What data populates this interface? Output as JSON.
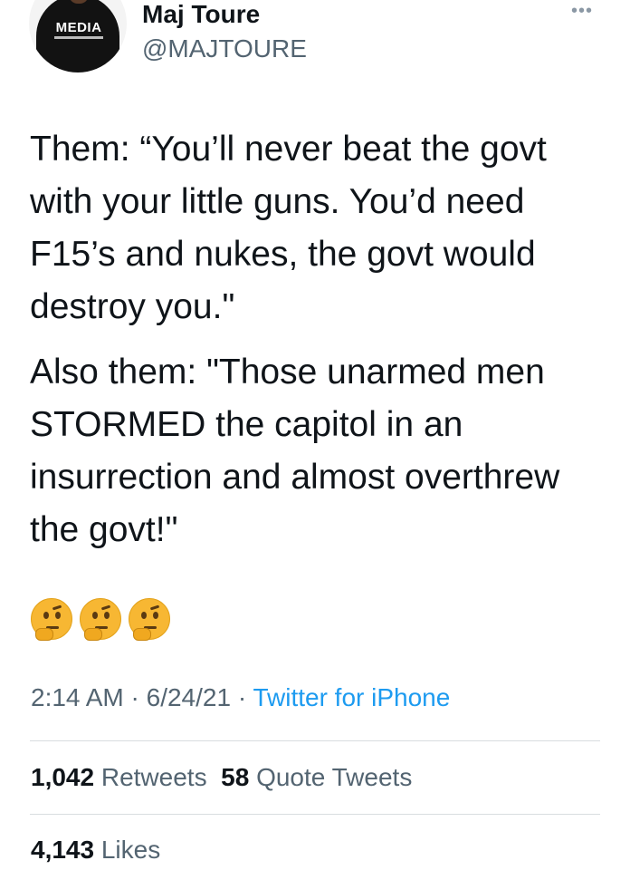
{
  "tweet": {
    "author": {
      "display_name": "Maj Toure",
      "handle": "@MAJTOURE",
      "avatar_logo_text": "MEDIA"
    },
    "more_icon": "more-horizontal-icon",
    "paragraphs": [
      "Them: “You’ll never beat the govt with your little guns. You’d need F15’s and nukes, the govt would destroy you.\"",
      "Also them: \"Those unarmed men STORMED the capitol in an insurrection and almost overthrew the govt!\""
    ],
    "emojis": [
      "thinking-face-icon",
      "thinking-face-icon",
      "thinking-face-icon"
    ],
    "time": "2:14 AM",
    "separator": "·",
    "date": "6/24/21",
    "source": "Twitter for iPhone",
    "stats": {
      "retweets_count": "1,042",
      "retweets_label": "Retweets",
      "quote_count": "58",
      "quote_label": "Quote Tweets",
      "likes_count": "4,143",
      "likes_label": "Likes"
    }
  },
  "colors": {
    "text_primary": "#0f1419",
    "text_secondary": "#536471",
    "link_blue": "#1d9bf0",
    "divider": "#d9dde0"
  }
}
